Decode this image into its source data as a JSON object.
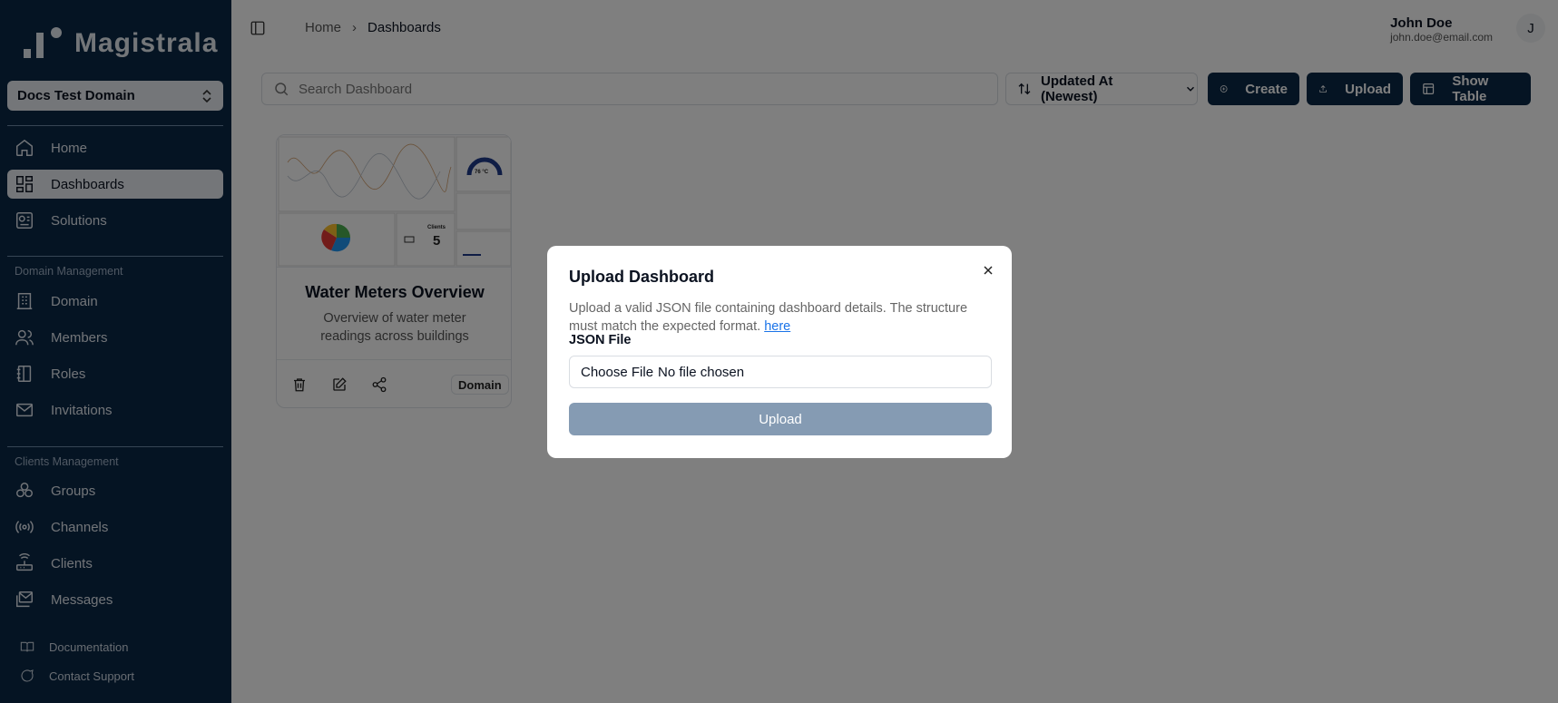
{
  "app": {
    "name": "Magistrala"
  },
  "sidebar": {
    "domain_selector": "Docs Test Domain",
    "items_main": [
      {
        "label": "Home",
        "icon": "home-icon"
      },
      {
        "label": "Dashboards",
        "icon": "dashboard-icon",
        "active": true
      },
      {
        "label": "Solutions",
        "icon": "solutions-icon"
      }
    ],
    "section_domain": "Domain Management",
    "items_domain": [
      {
        "label": "Domain",
        "icon": "building-icon"
      },
      {
        "label": "Members",
        "icon": "users-icon"
      },
      {
        "label": "Roles",
        "icon": "notebook-icon"
      },
      {
        "label": "Invitations",
        "icon": "mail-icon"
      }
    ],
    "section_clients": "Clients Management",
    "items_clients": [
      {
        "label": "Groups",
        "icon": "groups-icon"
      },
      {
        "label": "Channels",
        "icon": "radio-icon"
      },
      {
        "label": "Clients",
        "icon": "router-icon"
      },
      {
        "label": "Messages",
        "icon": "messages-icon"
      }
    ],
    "footer": [
      {
        "label": "Documentation",
        "icon": "book-icon"
      },
      {
        "label": "Contact Support",
        "icon": "chat-icon"
      }
    ]
  },
  "header": {
    "breadcrumb": [
      "Home",
      "Dashboards"
    ],
    "user_name": "John Doe",
    "user_email": "john.doe@email.com",
    "avatar_initial": "J"
  },
  "toolbar": {
    "search_placeholder": "Search Dashboard",
    "sort_label": "Updated At (Newest)",
    "create_label": "Create",
    "upload_label": "Upload",
    "show_table_label": "Show Table"
  },
  "dashboard_card": {
    "title": "Water Meters Overview",
    "description": "Overview of water meter readings across buildings",
    "badge": "Domain",
    "preview": {
      "gauge_value": "76 °C",
      "clients_label": "Clients",
      "clients_count": "5"
    }
  },
  "modal": {
    "title": "Upload Dashboard",
    "description": "Upload a valid JSON file containing dashboard details. The structure must match the expected format.",
    "link_text": "here",
    "field_label": "JSON File",
    "file_button": "Choose File",
    "file_status": "No file chosen",
    "submit_label": "Upload"
  },
  "colors": {
    "sidebar_bg": "#0b2847",
    "accent": "#0b2847",
    "disabled_button": "#859bb3"
  }
}
